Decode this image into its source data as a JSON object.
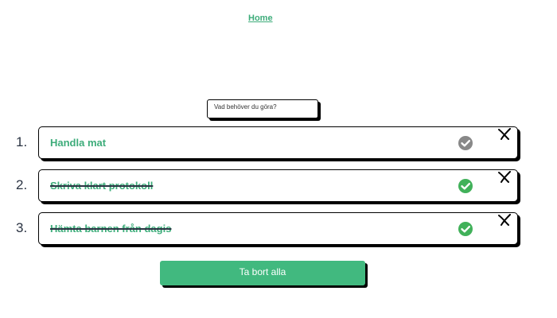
{
  "nav": {
    "home_label": "Home"
  },
  "input": {
    "placeholder": "Vad behöver du göra?"
  },
  "todos": [
    {
      "number": "1.",
      "text": "Handla mat",
      "done": false
    },
    {
      "number": "2.",
      "text": "Skriva klart protokoll",
      "done": true
    },
    {
      "number": "3.",
      "text": "Hämta barnen från dagis",
      "done": true
    }
  ],
  "clear_button": {
    "label": "Ta bort alla"
  },
  "icons": {
    "check": "check-circle-icon",
    "delete": "close-x-icon"
  },
  "colors": {
    "accent": "#41b97f",
    "text_green": "#3dac7a",
    "check_done": "#41b15a",
    "check_pending": "#888888"
  }
}
